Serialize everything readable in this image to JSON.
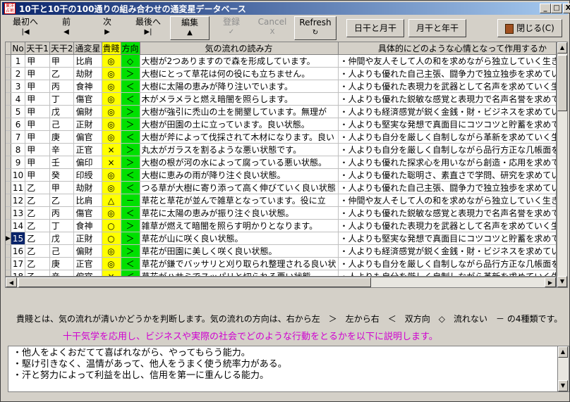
{
  "window": {
    "title": "10干と10干の100通りの組み合わせの通変星データベース",
    "app_icon_text": "東洋占術",
    "minimize": "_",
    "maximize": "□",
    "close": "X"
  },
  "toolbar": {
    "first": {
      "label": "最初へ",
      "symbol": "|◀"
    },
    "prev": {
      "label": "前",
      "symbol": "◀"
    },
    "next": {
      "label": "次",
      "symbol": "▶"
    },
    "last": {
      "label": "最後へ",
      "symbol": "▶|"
    },
    "edit": {
      "label": "編集",
      "symbol": "▲"
    },
    "register": {
      "label": "登録",
      "symbol": "✓"
    },
    "cancel": {
      "label": "Cancel",
      "symbol": "X"
    },
    "refresh": {
      "label": "Refresh",
      "symbol": "↻"
    },
    "day_month": "日干と月干",
    "month_year": "月干と年干",
    "close": "閉じる(C)"
  },
  "grid": {
    "columns": [
      "No",
      "天干1",
      "天干2",
      "通変星",
      "貴賤",
      "方向",
      "気の流れの読み方",
      "具体的にどのような心情となって作用するか"
    ],
    "selected_no": "15",
    "rows": [
      [
        "1",
        "甲",
        "甲",
        "比肩",
        "◎",
        "◇",
        "大樹が2つありますので森を形成しています。",
        "・仲間や友人そして人の和を求めながら独立していく生き方。"
      ],
      [
        "2",
        "甲",
        "乙",
        "劫財",
        "◎",
        "＞",
        "大樹にとって草花は何の役にも立ちません。",
        "・人よりも優れた自己主張、闘争力で独立独歩を求めていく生"
      ],
      [
        "3",
        "甲",
        "丙",
        "食神",
        "◎",
        "＜",
        "大樹に太陽の恵みが降り注いでいます。",
        "・人よりも優れた表現力を武器として名声を求めていく生き方。"
      ],
      [
        "4",
        "甲",
        "丁",
        "傷官",
        "◎",
        "＜",
        "木がメラメラと燃え暗闇を照らします。",
        "・人よりも優れた鋭敏な感覚と表現力で名声名誉を求めていく"
      ],
      [
        "5",
        "甲",
        "戊",
        "偏財",
        "◎",
        "＞",
        "大樹が強引に禿山の土を開墾しています。無理が",
        "・人よりも経済感覚が鋭く金銭・財・ビジネスを求めていく生き"
      ],
      [
        "6",
        "甲",
        "己",
        "正財",
        "◎",
        "＞",
        "大樹が田園の土に立っています。良い状態。",
        "・人よりも堅実な発想で真面目にコツコツと貯蓄を求めていく"
      ],
      [
        "7",
        "甲",
        "庚",
        "偏官",
        "◎",
        "＜",
        "大樹が斧によって伐採されて木材になります。良い",
        "・人よりも自分を厳しく自制しながら革新を求めていく生き方。"
      ],
      [
        "8",
        "甲",
        "辛",
        "正官",
        "×",
        "＞",
        "丸太がガラスを割るような悪い状態です。",
        "・人よりも自分を厳しく自制しながら品行方正な几帳面を求め"
      ],
      [
        "9",
        "甲",
        "壬",
        "偏印",
        "×",
        "＞",
        "大樹の根が河の水によって腐っている悪い状態。",
        "・人よりも優れた探求心を用いながら創造・応用を求めていく生"
      ],
      [
        "10",
        "甲",
        "癸",
        "印綬",
        "◎",
        "＜",
        "大樹に恵みの雨が降り注ぐ良い状態。",
        "・人よりも優れた聡明さ、素直さで学問、研究を求めていく生き"
      ],
      [
        "11",
        "乙",
        "甲",
        "劫財",
        "◎",
        "＜",
        "つる草が大樹に寄り添って高く伸びていく良い状態",
        "・人よりも優れた自己主張、闘争力で独立独歩を求めていく生"
      ],
      [
        "12",
        "乙",
        "乙",
        "比肩",
        "△",
        "－",
        "草花と草花が並んで雑草となっています。役に立",
        "・仲間や友人そして人の和を求めながら独立していく生き方。"
      ],
      [
        "13",
        "乙",
        "丙",
        "傷官",
        "◎",
        "＜",
        "草花に太陽の恵みが振り注ぐ良い状態。",
        "・人よりも優れた鋭敏な感覚と表現力で名声名誉を求めていく"
      ],
      [
        "14",
        "乙",
        "丁",
        "食神",
        "○",
        "＞",
        "雑草が燃えて暗闇を照らす明かりとなります。",
        "・人よりも優れた表現力を武器として名声を求めていく生き方。"
      ],
      [
        "15",
        "乙",
        "戊",
        "正財",
        "○",
        "＞",
        "草花が山に咲く良い状態。",
        "・人よりも堅実な発想で真面目にコツコツと貯蓄を求めていく"
      ],
      [
        "16",
        "乙",
        "己",
        "偏財",
        "◎",
        "＞",
        "草花が田園に美しく咲く良い状態。",
        "・人よりも経済感覚が鋭く金銭・財・ビジネスを求めていく生き"
      ],
      [
        "17",
        "乙",
        "庚",
        "正官",
        "◎",
        "＜",
        "草花が鎌でバッサリと刈り取られ整理される良い状",
        "・人よりも自分を厳しく自制しながら品行方正な几帳面を求め"
      ],
      [
        "18",
        "乙",
        "辛",
        "偏官",
        "×",
        "＜",
        "草花がハサミでスッパリと切られる悪い状態。",
        "・人よりも自分を厳しく自制しながら革新を求めていく生き方。"
      ]
    ]
  },
  "legend": "貴賤とは、気の流れが清いかどうかを判断します。気の流れの方向は、右から左　＞　左から右　＜　双方向　◇　流れない　－ の4種類です。",
  "subtitle": "十干気学を応用し、ビジネスや実際の社会でどのような行動をとるかを以下に説明します。",
  "detail_lines": [
    "・他人をよくおだてて喜ばれながら、やってもらう能力。",
    "・駆け引きなく、温情があって、他人をうまく使う統率力がある。",
    "・汗と努力によって利益を出し、信用を第一に重んじる能力。"
  ],
  "colors": {
    "kisen": "#ffff00",
    "direction": "#00e000",
    "title_start": "#0a246a",
    "subtitle": "#d000d0"
  }
}
